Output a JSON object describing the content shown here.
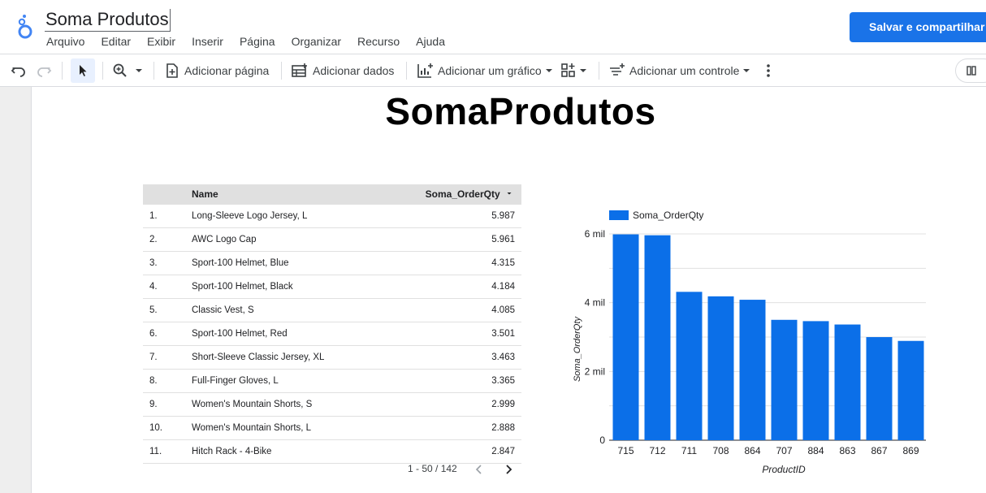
{
  "app": {
    "document_title": "Soma Produtos",
    "menu": [
      "Arquivo",
      "Editar",
      "Exibir",
      "Inserir",
      "Página",
      "Organizar",
      "Recurso",
      "Ajuda"
    ],
    "share_label": "Salvar e compartilhar"
  },
  "toolbar": {
    "undo_icon": "undo-icon",
    "redo_icon": "redo-icon",
    "select_icon": "cursor-icon",
    "zoom_icon": "zoom-icon",
    "add_page_label": "Adicionar página",
    "add_data_label": "Adicionar dados",
    "add_chart_label": "Adicionar um gráfico",
    "add_control_label": "Adicionar um controle"
  },
  "report": {
    "title": "SomaProdutos"
  },
  "table": {
    "col_name": "Name",
    "col_value": "Soma_OrderQty",
    "rows": [
      {
        "idx": "1.",
        "name": "Long-Sleeve Logo Jersey, L",
        "value": "5.987"
      },
      {
        "idx": "2.",
        "name": "AWC Logo Cap",
        "value": "5.961"
      },
      {
        "idx": "3.",
        "name": "Sport-100 Helmet, Blue",
        "value": "4.315"
      },
      {
        "idx": "4.",
        "name": "Sport-100 Helmet, Black",
        "value": "4.184"
      },
      {
        "idx": "5.",
        "name": "Classic Vest, S",
        "value": "4.085"
      },
      {
        "idx": "6.",
        "name": "Sport-100 Helmet, Red",
        "value": "3.501"
      },
      {
        "idx": "7.",
        "name": "Short-Sleeve Classic Jersey, XL",
        "value": "3.463"
      },
      {
        "idx": "8.",
        "name": "Full-Finger Gloves, L",
        "value": "3.365"
      },
      {
        "idx": "9.",
        "name": "Women's Mountain Shorts, S",
        "value": "2.999"
      },
      {
        "idx": "10.",
        "name": "Women's Mountain Shorts, L",
        "value": "2.888"
      },
      {
        "idx": "11.",
        "name": "Hitch Rack - 4-Bike",
        "value": "2.847"
      }
    ],
    "pager": "1 - 50 / 142"
  },
  "chart_data": {
    "type": "bar",
    "categories": [
      "715",
      "712",
      "711",
      "708",
      "864",
      "707",
      "884",
      "863",
      "867",
      "869"
    ],
    "series": [
      {
        "name": "Soma_OrderQty",
        "values": [
          5987,
          5961,
          4315,
          4184,
          4085,
          3501,
          3463,
          3365,
          2999,
          2888
        ]
      }
    ],
    "xlabel": "ProductID",
    "ylabel": "Soma_OrderQty",
    "ylim": [
      0,
      6000
    ],
    "yticks": [
      {
        "value": 0,
        "label": "0"
      },
      {
        "value": 2000,
        "label": "2 mil"
      },
      {
        "value": 4000,
        "label": "4 mil"
      },
      {
        "value": 6000,
        "label": "6 mil"
      }
    ],
    "grid": true,
    "legend": "top-left",
    "color": "#0b6fe8"
  }
}
